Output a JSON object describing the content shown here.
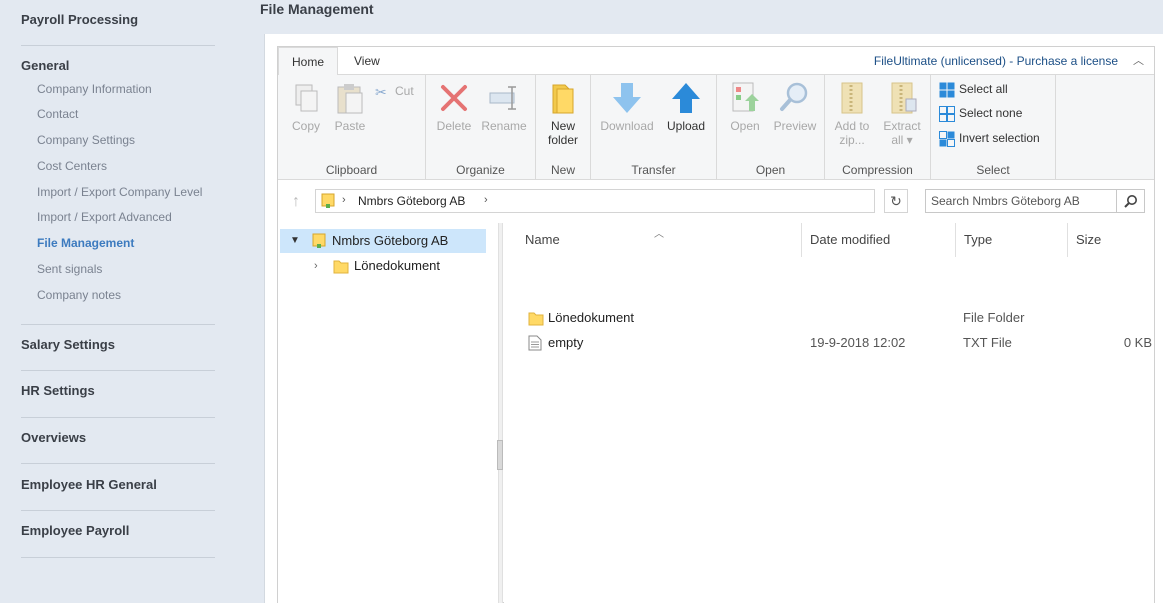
{
  "sidebar": {
    "payroll_processing": "Payroll Processing",
    "general": "General",
    "general_items": [
      "Company Information",
      "Contact",
      "Company Settings",
      "Cost Centers",
      "Import / Export Company Level",
      "Import / Export Advanced",
      "File Management",
      "Sent signals",
      "Company notes"
    ],
    "salary_settings": "Salary Settings",
    "hr_settings": "HR Settings",
    "overviews": "Overviews",
    "employee_hr_general": "Employee HR General",
    "employee_payroll": "Employee Payroll"
  },
  "page": {
    "title": "File Management"
  },
  "ribbon": {
    "tabs": [
      "Home",
      "View"
    ],
    "license_text": "FileUltimate (unlicensed) - Purchase a license",
    "collapse_glyph": "︿",
    "groups": {
      "clipboard": {
        "label": "Clipboard",
        "copy": "Copy",
        "paste": "Paste",
        "cut": "Cut"
      },
      "organize": {
        "label": "Organize",
        "delete": "Delete",
        "rename": "Rename"
      },
      "new": {
        "label": "New",
        "new_folder_1": "New",
        "new_folder_2": "folder"
      },
      "transfer": {
        "label": "Transfer",
        "download": "Download",
        "upload": "Upload"
      },
      "open": {
        "label": "Open",
        "open": "Open",
        "preview": "Preview"
      },
      "compression": {
        "label": "Compression",
        "add_zip_1": "Add to",
        "add_zip_2": "zip...",
        "extract_1": "Extract",
        "extract_2": "all ▾"
      },
      "select": {
        "label": "Select",
        "select_all": "Select all",
        "select_none": "Select none",
        "invert": "Invert selection"
      }
    }
  },
  "address": {
    "crumb": "Nmbrs Göteborg AB",
    "search_placeholder": "Search Nmbrs Göteborg AB"
  },
  "tree": {
    "root": "Nmbrs Göteborg AB",
    "children": [
      "Lönedokument"
    ]
  },
  "list": {
    "columns": [
      "Name",
      "Date modified",
      "Type",
      "Size"
    ],
    "rows": [
      {
        "name": "Lönedokument",
        "date": "",
        "type": "File Folder",
        "size": ""
      },
      {
        "name": "empty",
        "date": "19-9-2018 12:02",
        "type": "TXT File",
        "size": "0 KB"
      }
    ]
  },
  "colors": {
    "accent": "#3d7bbf",
    "selection": "#cde6fb",
    "upload_blue": "#2b8ad9",
    "delete_red": "#e04545"
  }
}
